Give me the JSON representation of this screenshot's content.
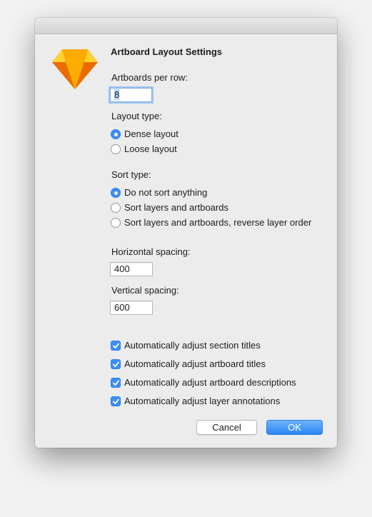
{
  "dialog": {
    "title": "Artboard Layout Settings",
    "artboards_per_row_label": "Artboards per row:",
    "artboards_per_row_value": "8",
    "layout_type_label": "Layout type:",
    "layout_options": [
      {
        "label": "Dense layout",
        "selected": true
      },
      {
        "label": "Loose layout",
        "selected": false
      }
    ],
    "sort_type_label": "Sort type:",
    "sort_options": [
      {
        "label": "Do not sort anything",
        "selected": true
      },
      {
        "label": "Sort layers and artboards",
        "selected": false
      },
      {
        "label": "Sort layers and artboards, reverse layer order",
        "selected": false
      }
    ],
    "horizontal_spacing_label": "Horizontal spacing:",
    "horizontal_spacing_value": "400",
    "vertical_spacing_label": "Vertical spacing:",
    "vertical_spacing_value": "600",
    "checkboxes": [
      {
        "label": "Automatically adjust section titles",
        "checked": true
      },
      {
        "label": "Automatically adjust artboard titles",
        "checked": true
      },
      {
        "label": "Automatically adjust artboard descriptions",
        "checked": true
      },
      {
        "label": "Automatically adjust layer annotations",
        "checked": true
      }
    ],
    "cancel_label": "Cancel",
    "ok_label": "OK"
  },
  "icons": {
    "app": "sketch-diamond-icon"
  },
  "colors": {
    "accent": "#3b8ef6",
    "window_bg": "#ececec"
  }
}
